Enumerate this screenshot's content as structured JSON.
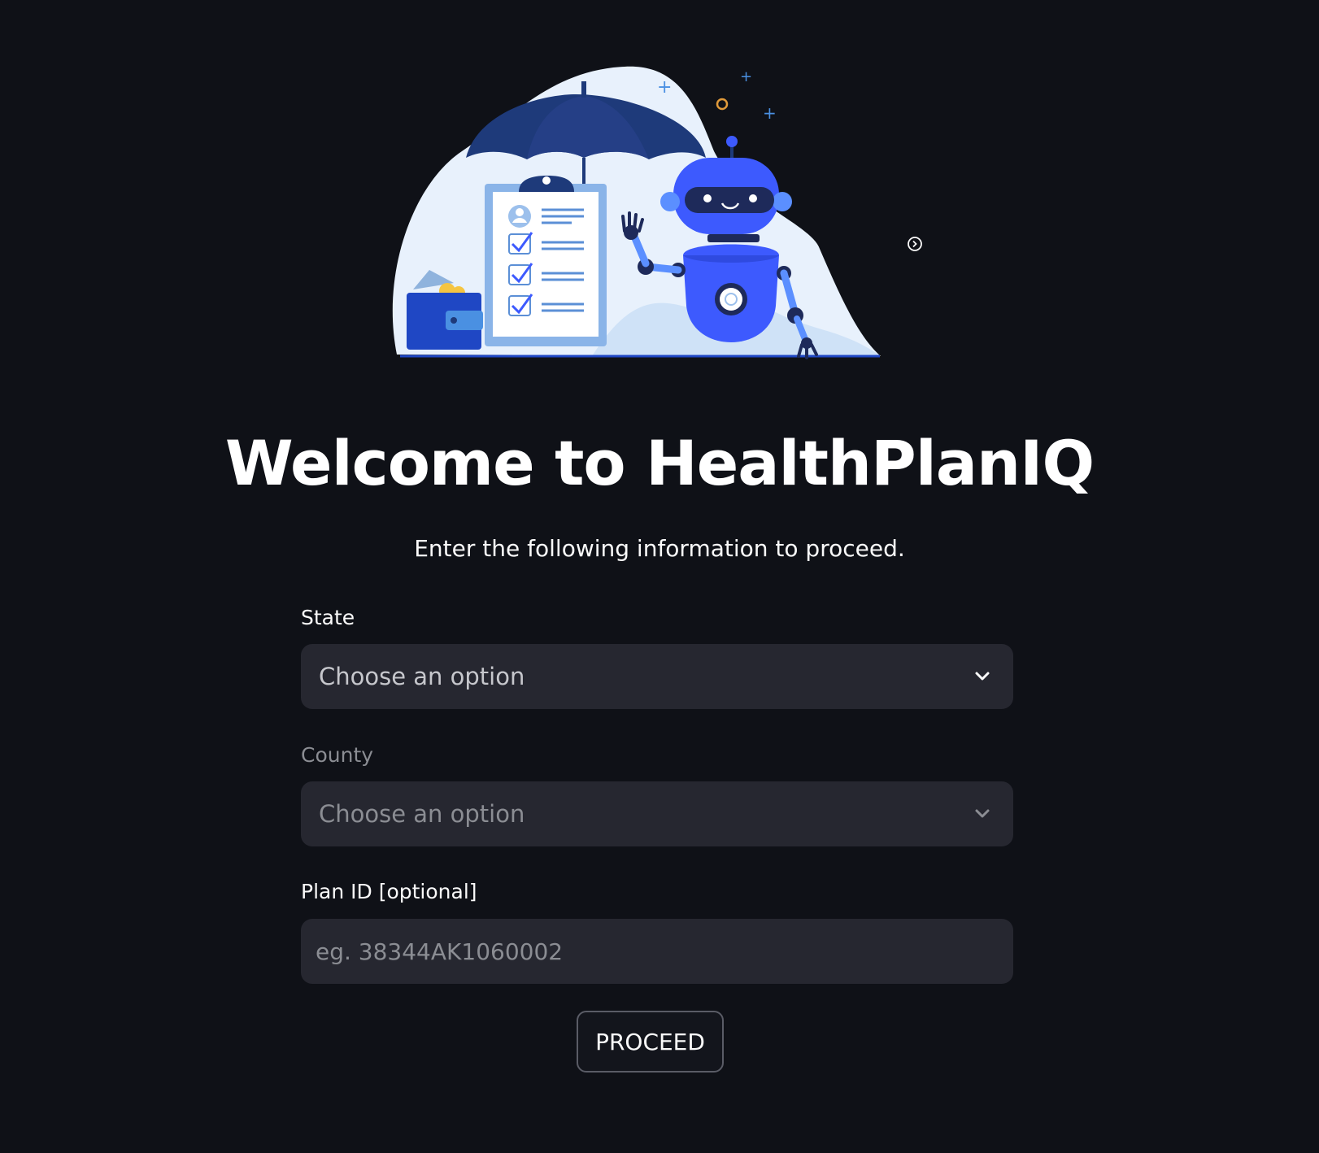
{
  "hero": {
    "image_name": "insurance-robot-illustration",
    "expand_icon": "fullscreen-icon"
  },
  "header": {
    "title": "Welcome to HealthPlanIQ",
    "subtitle": "Enter the following information to proceed."
  },
  "form": {
    "state": {
      "label": "State",
      "placeholder": "Choose an option",
      "disabled": false
    },
    "county": {
      "label": "County",
      "placeholder": "Choose an option",
      "disabled": true
    },
    "plan_id": {
      "label": "Plan ID [optional]",
      "value": "",
      "placeholder": "eg. 38344AK1060002"
    },
    "proceed_label": "PROCEED"
  },
  "colors": {
    "background": "#0f1117",
    "input_bg": "#262730",
    "brand_blue": "#3d5afe",
    "navy": "#1e3a8a"
  }
}
